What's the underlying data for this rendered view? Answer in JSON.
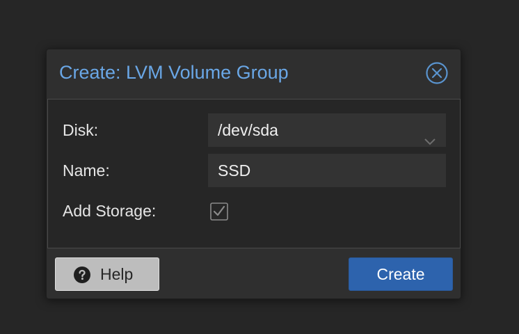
{
  "dialog": {
    "title": "Create: LVM Volume Group",
    "close_icon": "close-circle-icon"
  },
  "form": {
    "disk": {
      "label": "Disk:",
      "value": "/dev/sda",
      "dropdown_icon": "chevron-down-icon"
    },
    "name": {
      "label": "Name:",
      "value": "SSD"
    },
    "add_storage": {
      "label": "Add Storage:",
      "checked": true,
      "icon": "checkmark-icon"
    }
  },
  "footer": {
    "help_label": "Help",
    "help_icon": "question-circle-icon",
    "create_label": "Create"
  },
  "colors": {
    "title": "#6aa7e6",
    "primary_button": "#2d63ad",
    "help_button": "#bdbdbd",
    "background": "#262626"
  }
}
